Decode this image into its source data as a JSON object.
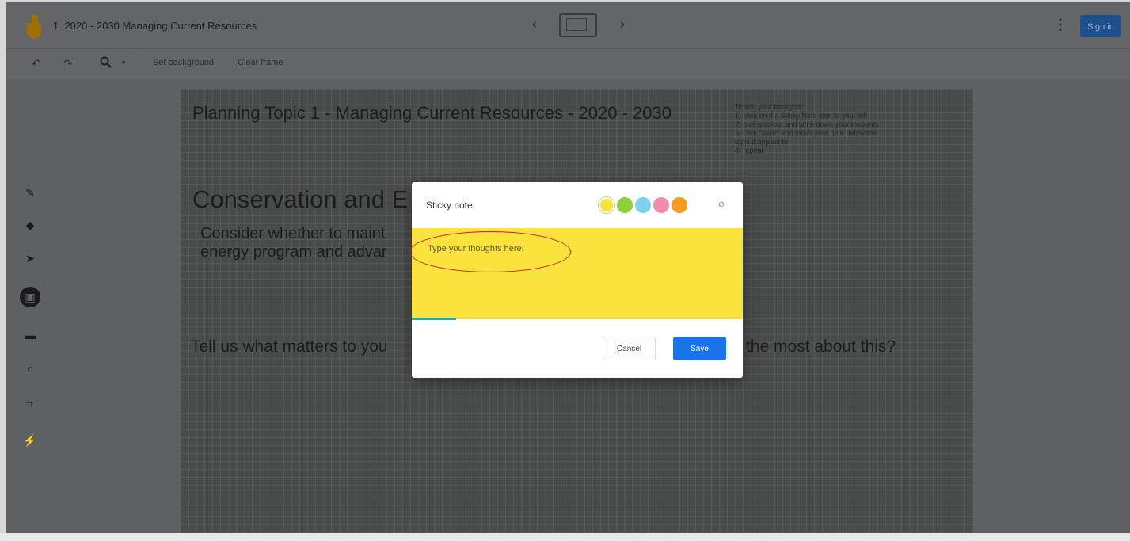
{
  "app": {
    "title": "1. 2020 - 2030 Managing Current Resources",
    "sign_in_label": "Sign in"
  },
  "header_icons": {
    "logo": "jamboard-logo-icon",
    "prev": "chevron-left-icon",
    "prev_glyph": "‹",
    "next": "chevron-right-icon",
    "next_glyph": "›",
    "frame_bar": "frame-bar-icon",
    "more": "more-vert-icon",
    "more_glyph": "⋮"
  },
  "toolbar": {
    "undo_glyph": "↶",
    "redo_glyph": "↷",
    "zoom_glyph": "🔍",
    "zoom_arrow": "▾",
    "set_background": "Set background",
    "clear_frame": "Clear frame"
  },
  "tools": [
    {
      "name": "pen",
      "icon": "pen-icon",
      "glyph": "✎"
    },
    {
      "name": "eraser",
      "icon": "eraser-icon",
      "glyph": "◆"
    },
    {
      "name": "select",
      "icon": "select-arrow-icon",
      "glyph": "➤"
    },
    {
      "name": "sticky-note",
      "icon": "sticky-note-icon",
      "glyph": "▣",
      "active": true
    },
    {
      "name": "add-image",
      "icon": "image-icon",
      "glyph": "▬"
    },
    {
      "name": "circle",
      "icon": "circle-icon",
      "glyph": "○"
    },
    {
      "name": "text-box",
      "icon": "text-box-icon",
      "glyph": "⌗"
    },
    {
      "name": "laser",
      "icon": "laser-icon",
      "glyph": "⚡"
    }
  ],
  "canvas": {
    "heading": "Planning Topic 1 - Managing Current Resources - 2020 - 2030",
    "title_visible": "Conservation and E",
    "body_visible": "Consider whether to maint\nenergy program and advar",
    "question_left": "Tell us what matters to you",
    "question_right": "the most about this?",
    "instructions": "To add your thoughts:\n1) click on the Sticky Note icon to your left\n2) pick a colour and write down your thoughts\n3) click \"save\" and move your note below the\ntopic it applies to\n4) repeat"
  },
  "dialog": {
    "title": "Sticky note",
    "placeholder": "Type your thoughts here!",
    "cancel_label": "Cancel",
    "save_label": "Save",
    "no_color_icon": "no-color-icon",
    "no_color_glyph": "⊘",
    "colors": [
      {
        "name": "yellow",
        "hex": "#f8e23d",
        "selected": true
      },
      {
        "name": "green",
        "hex": "#8fcf3b"
      },
      {
        "name": "blue",
        "hex": "#7fd0ea"
      },
      {
        "name": "pink",
        "hex": "#f38bb0"
      },
      {
        "name": "orange",
        "hex": "#f49b20"
      }
    ],
    "note_color": "#fbe33d"
  },
  "colors": {
    "accent": "#1a73e8",
    "annotation": "#d12020"
  }
}
